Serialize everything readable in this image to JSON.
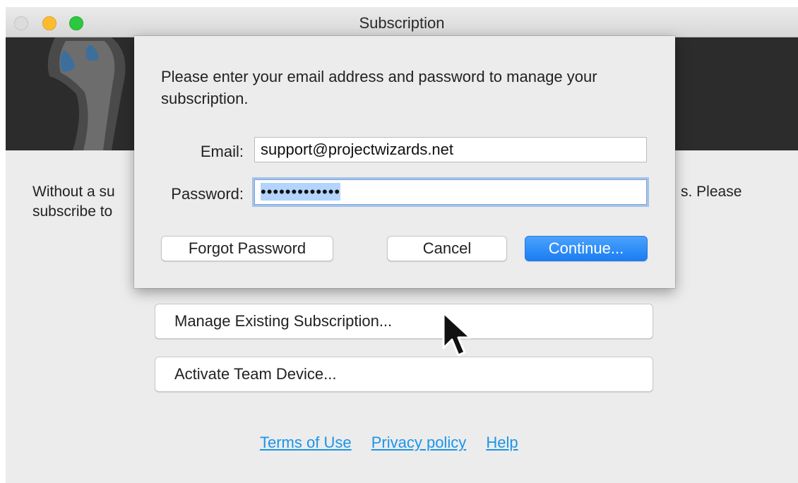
{
  "window": {
    "title": "Subscription"
  },
  "body": {
    "text_line1_left": "Without a su",
    "text_line1_right": "s. Please",
    "text_line2_left": "subscribe to"
  },
  "buttons": {
    "manage": "Manage Existing Subscription...",
    "activate": "Activate Team Device..."
  },
  "links": [
    "Terms of Use",
    "Privacy policy",
    "Help"
  ],
  "sheet": {
    "message": "Please enter your email address and password to manage your subscription.",
    "email_label": "Email:",
    "email_value": "support@projectwizards.net",
    "password_label": "Password:",
    "password_value": "•••••••••••••",
    "forgot": "Forgot Password",
    "cancel": "Cancel",
    "continue": "Continue..."
  },
  "colors": {
    "accent": "#1b7df3",
    "link": "#1b95e8",
    "banner": "#2c2c2c"
  }
}
